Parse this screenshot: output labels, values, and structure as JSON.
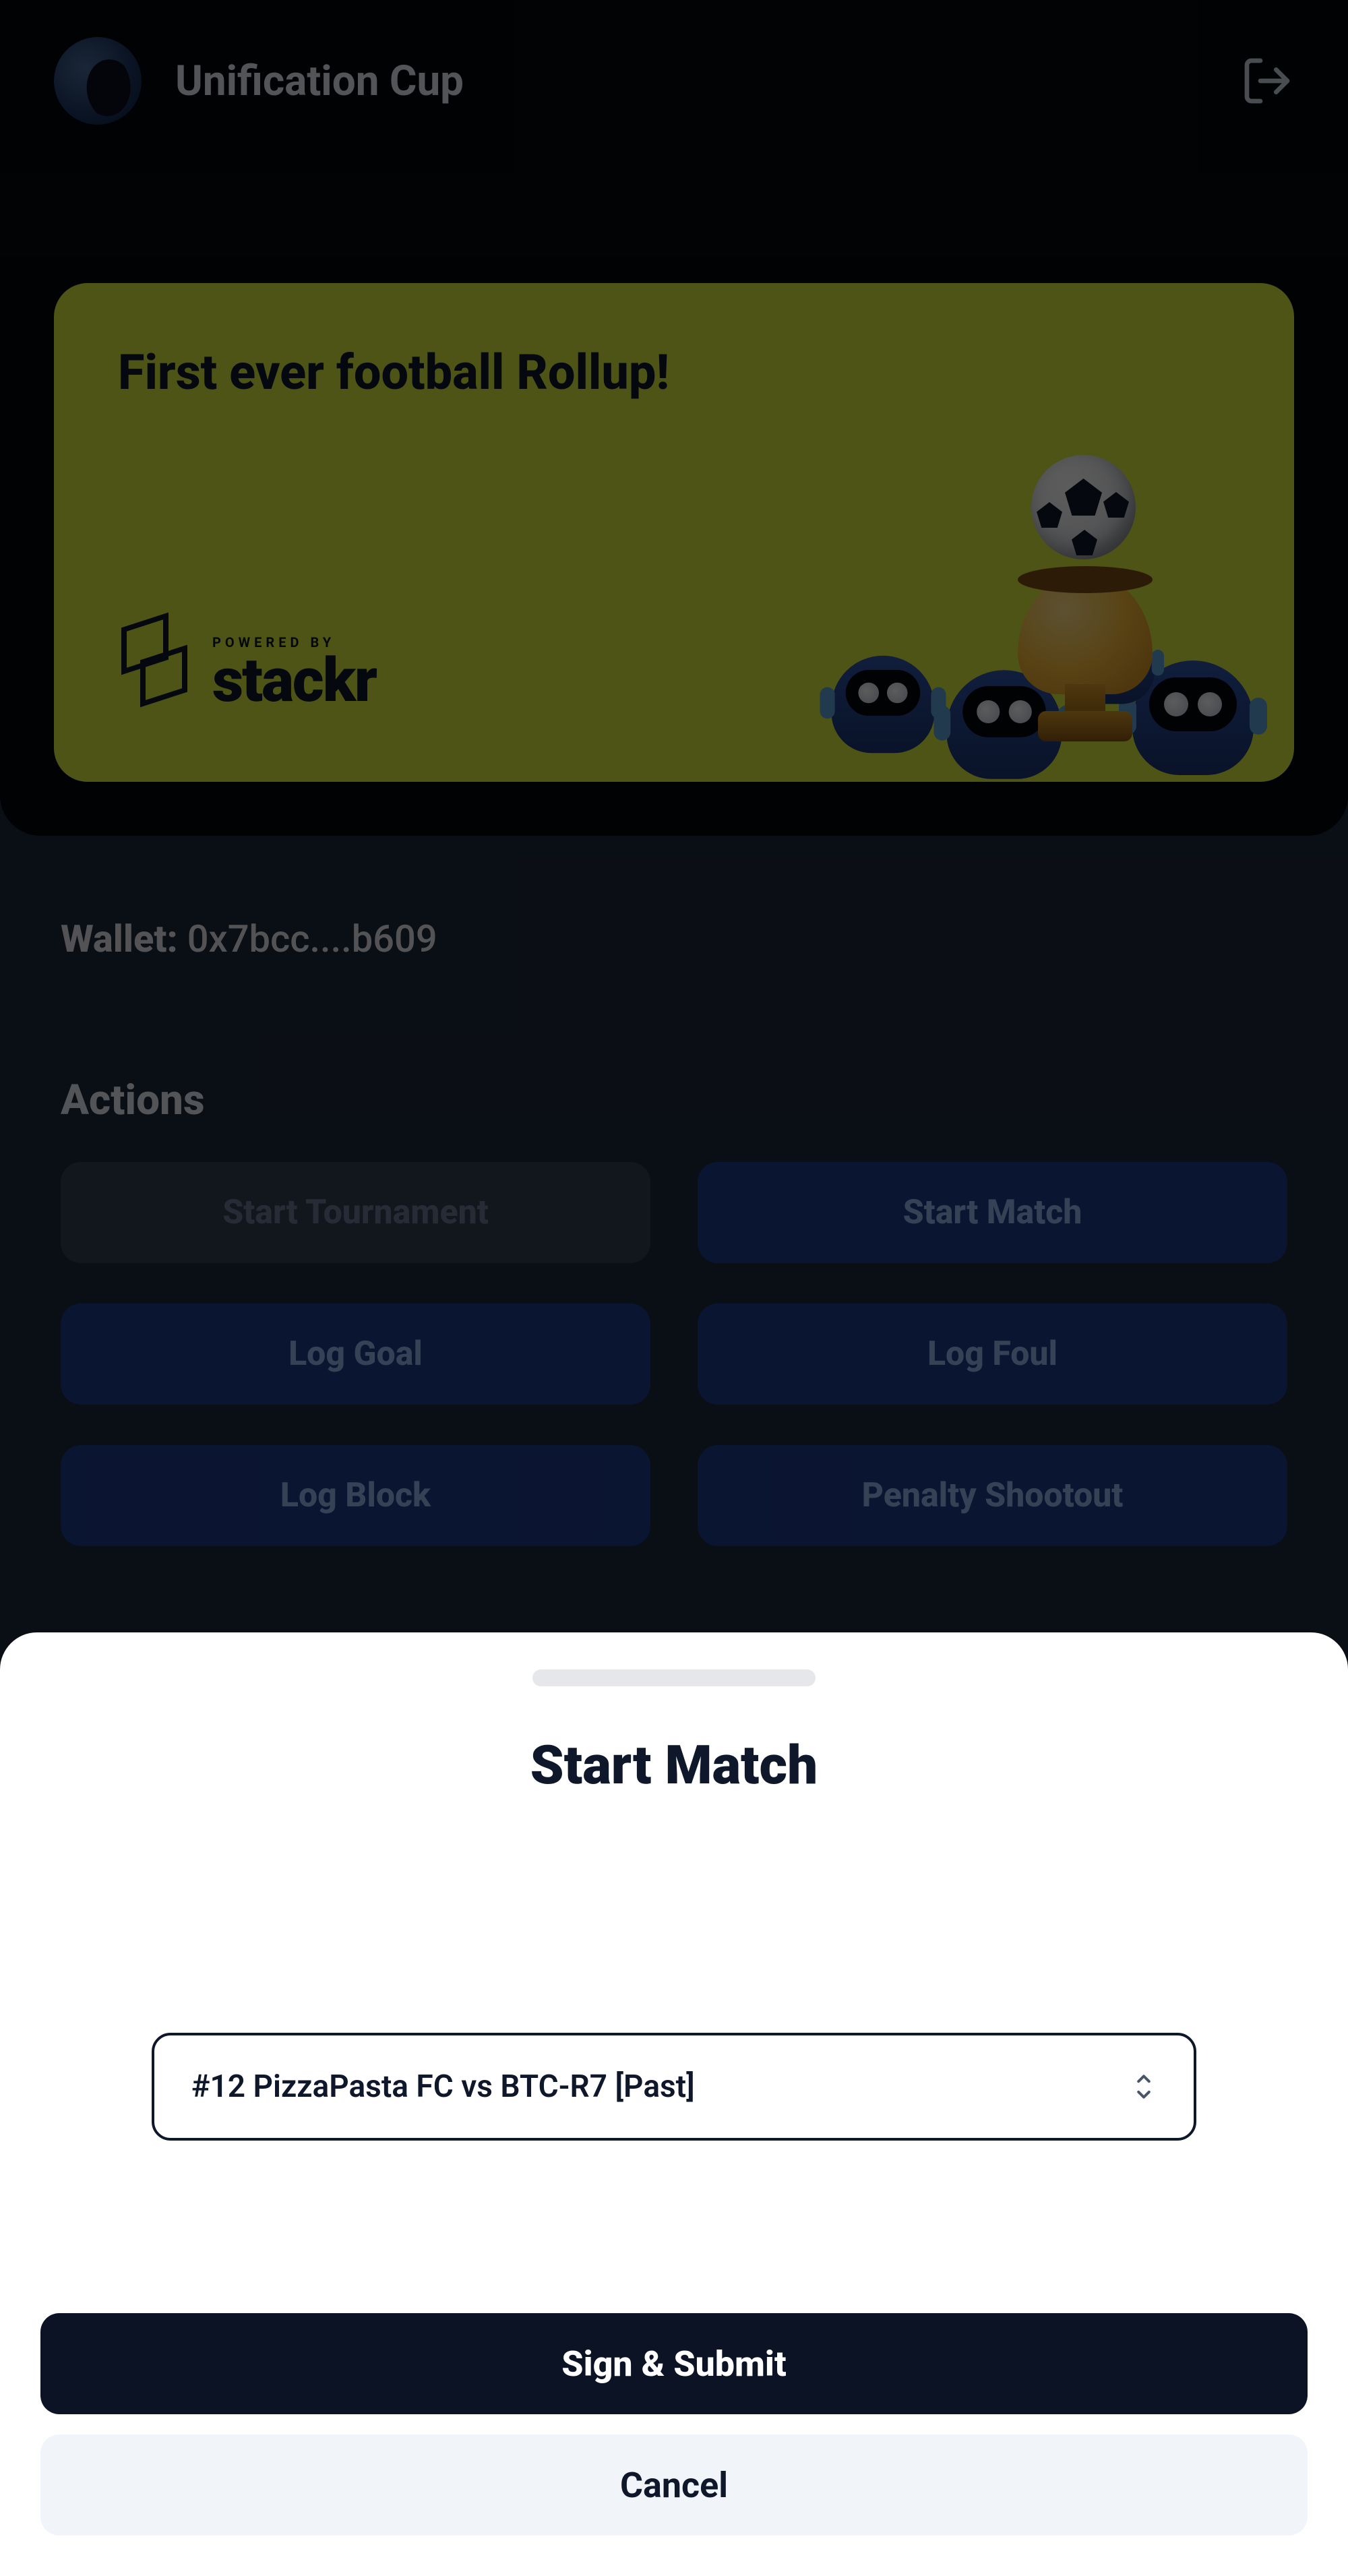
{
  "header": {
    "app_title": "Unification Cup"
  },
  "banner": {
    "headline": "First ever football Rollup!",
    "powered_by_label": "POWERED BY",
    "brand": "stackr"
  },
  "wallet": {
    "label": "Wallet:",
    "value": "0x7bcc....b609"
  },
  "actions": {
    "heading": "Actions",
    "buttons": [
      {
        "label": "Start Tournament",
        "disabled": true
      },
      {
        "label": "Start Match",
        "disabled": false
      },
      {
        "label": "Log Goal",
        "disabled": false
      },
      {
        "label": "Log Foul",
        "disabled": false
      },
      {
        "label": "Log Block",
        "disabled": false
      },
      {
        "label": "Penalty Shootout",
        "disabled": false
      }
    ]
  },
  "sheet": {
    "title": "Start Match",
    "selected_match": "#12 PizzaPasta FC vs BTC-R7 [Past]",
    "submit_label": "Sign & Submit",
    "cancel_label": "Cancel"
  }
}
